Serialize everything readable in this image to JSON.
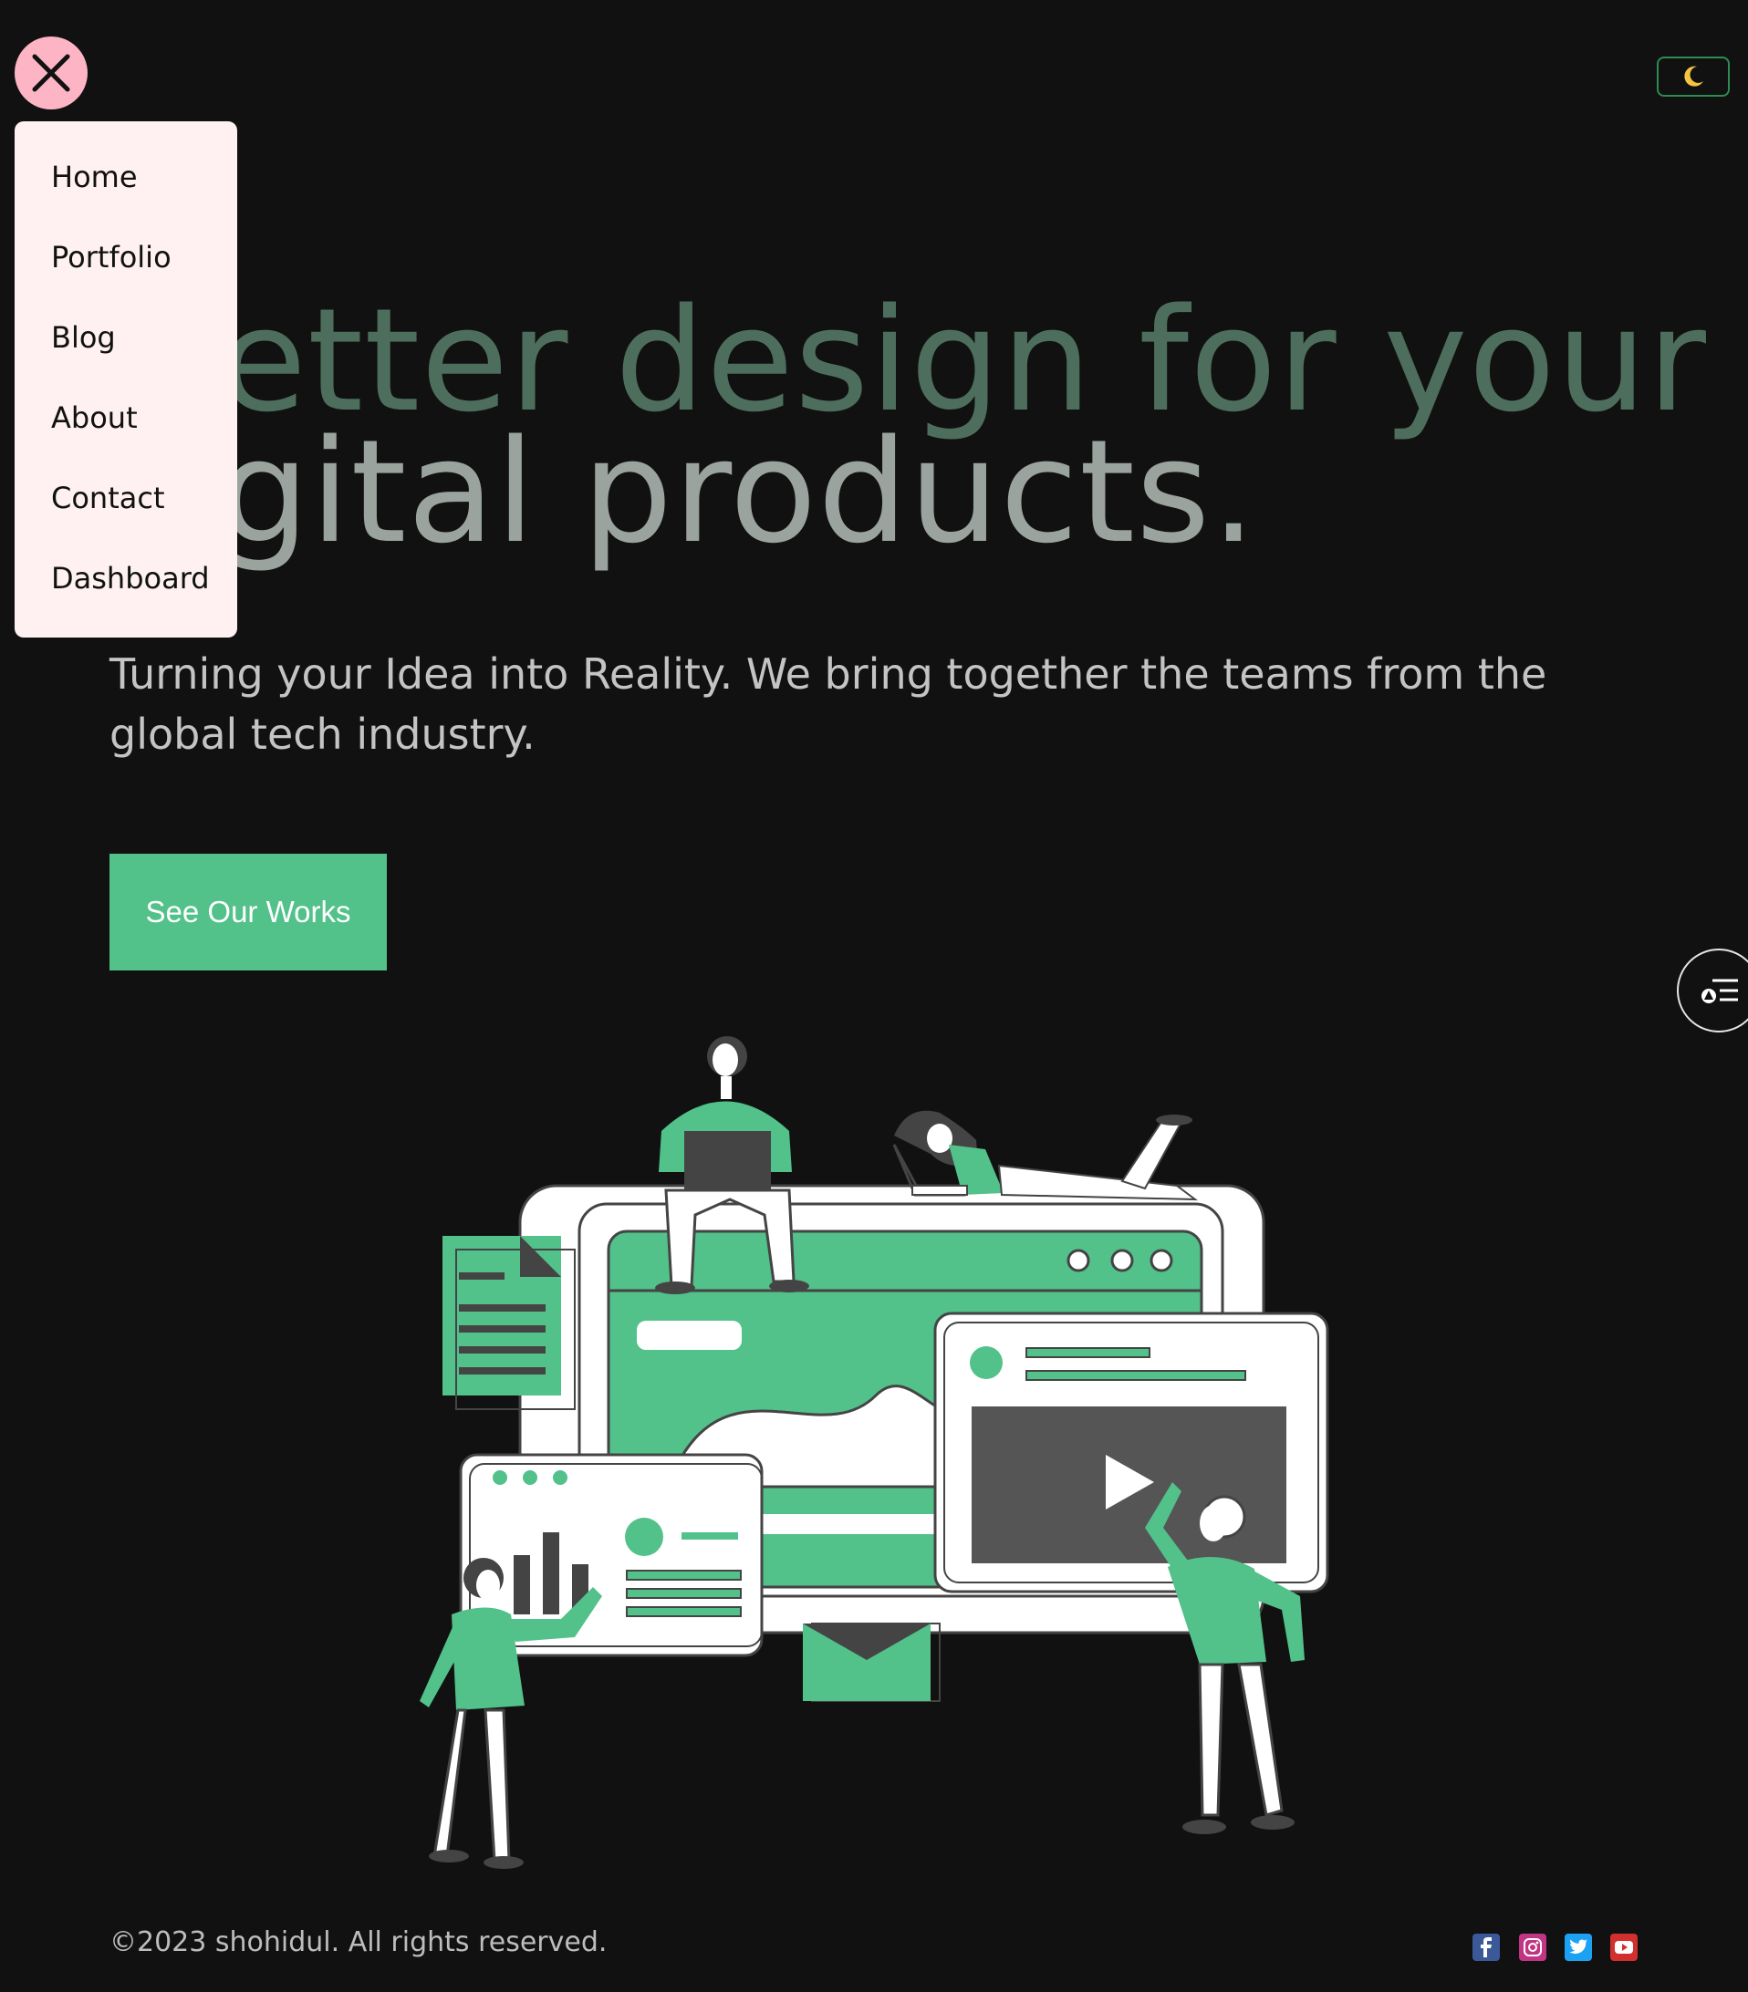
{
  "hero": {
    "line1": "etter design for your",
    "line2": "gital products.",
    "subtitle": "Turning your Idea into Reality. We bring together the teams from the global tech industry.",
    "cta_label": "See Our Works"
  },
  "menu": {
    "items": [
      {
        "label": "Home"
      },
      {
        "label": "Portfolio"
      },
      {
        "label": "Blog"
      },
      {
        "label": "About"
      },
      {
        "label": "Contact"
      },
      {
        "label": "Dashboard"
      }
    ]
  },
  "theme_toggle": {
    "icon": "moon-icon",
    "glyph": "🌙"
  },
  "footer": {
    "copyright": "©2023 shohidul. All rights reserved.",
    "social": [
      {
        "name": "facebook-icon",
        "color": "#3b5998"
      },
      {
        "name": "instagram-icon",
        "color": "#c13584"
      },
      {
        "name": "twitter-icon",
        "color": "#1da1f2"
      },
      {
        "name": "youtube-icon",
        "color": "#d1302f"
      }
    ]
  },
  "colors": {
    "background": "#111111",
    "accent": "#52c18a",
    "menu_bg": "#fff1f1",
    "close_bg": "#fdb5c5"
  }
}
